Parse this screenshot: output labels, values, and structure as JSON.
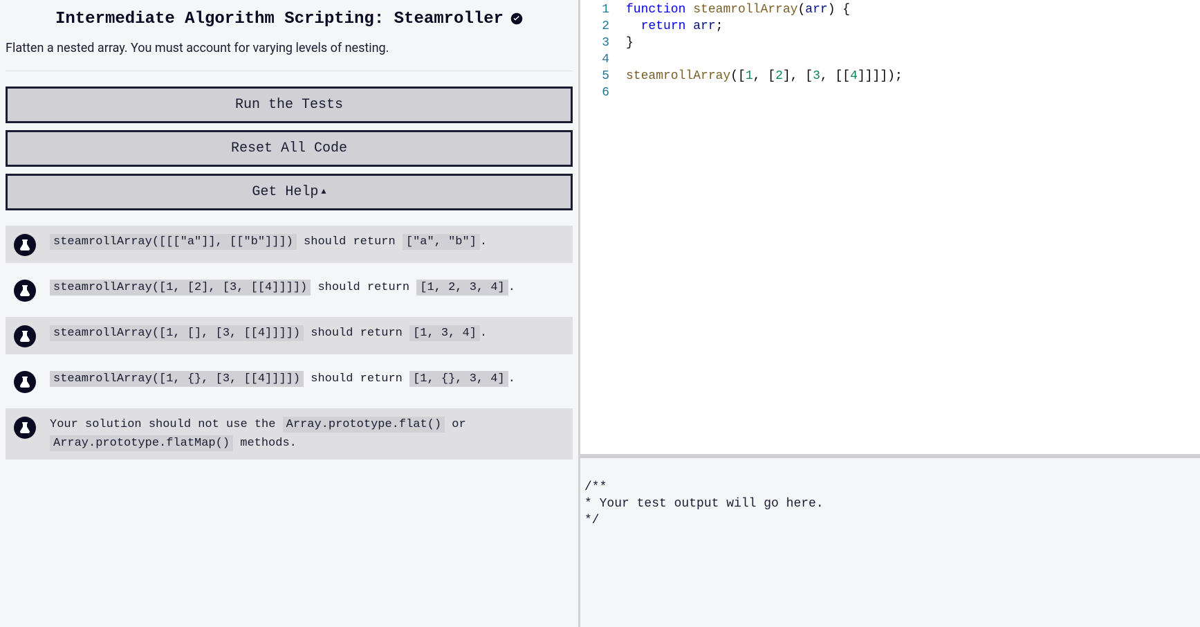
{
  "title": "Intermediate Algorithm Scripting: Steamroller",
  "description": "Flatten a nested array. You must account for varying levels of nesting.",
  "buttons": {
    "run": "Run the Tests",
    "reset": "Reset All Code",
    "help": "Get Help"
  },
  "tests": [
    {
      "segments": [
        {
          "t": "code",
          "v": "steamrollArray([[[\"a\"]], [[\"b\"]]])"
        },
        {
          "t": "text",
          "v": " should return "
        },
        {
          "t": "code",
          "v": "[\"a\", \"b\"]"
        },
        {
          "t": "text",
          "v": "."
        }
      ]
    },
    {
      "segments": [
        {
          "t": "code",
          "v": "steamrollArray([1, [2], [3, [[4]]]])"
        },
        {
          "t": "text",
          "v": " should return "
        },
        {
          "t": "code",
          "v": "[1, 2, 3, 4]"
        },
        {
          "t": "text",
          "v": "."
        }
      ]
    },
    {
      "segments": [
        {
          "t": "code",
          "v": "steamrollArray([1, [], [3, [[4]]]])"
        },
        {
          "t": "text",
          "v": " should return "
        },
        {
          "t": "code",
          "v": "[1, 3, 4]"
        },
        {
          "t": "text",
          "v": "."
        }
      ]
    },
    {
      "segments": [
        {
          "t": "code",
          "v": "steamrollArray([1, {}, [3, [[4]]]])"
        },
        {
          "t": "text",
          "v": " should return "
        },
        {
          "t": "code",
          "v": "[1, {}, 3, 4]"
        },
        {
          "t": "text",
          "v": "."
        }
      ]
    },
    {
      "segments": [
        {
          "t": "text",
          "v": "Your solution should not use the "
        },
        {
          "t": "code",
          "v": "Array.prototype.flat()"
        },
        {
          "t": "text",
          "v": " or "
        },
        {
          "t": "code",
          "v": "Array.prototype.flatMap()"
        },
        {
          "t": "text",
          "v": " methods."
        }
      ]
    }
  ],
  "editor": {
    "line_numbers": [
      "1",
      "2",
      "3",
      "4",
      "5",
      "6"
    ],
    "lines": [
      [
        {
          "c": "tok-kw",
          "v": "function"
        },
        {
          "c": "",
          "v": " "
        },
        {
          "c": "tok-fn",
          "v": "steamrollArray"
        },
        {
          "c": "tok-punc",
          "v": "("
        },
        {
          "c": "tok-id",
          "v": "arr"
        },
        {
          "c": "tok-punc",
          "v": ") {"
        }
      ],
      [
        {
          "c": "",
          "v": "  "
        },
        {
          "c": "tok-kw",
          "v": "return"
        },
        {
          "c": "",
          "v": " "
        },
        {
          "c": "tok-id",
          "v": "arr"
        },
        {
          "c": "tok-punc",
          "v": ";"
        }
      ],
      [
        {
          "c": "tok-punc",
          "v": "}"
        }
      ],
      [],
      [
        {
          "c": "tok-fn",
          "v": "steamrollArray"
        },
        {
          "c": "tok-punc",
          "v": "(["
        },
        {
          "c": "tok-num",
          "v": "1"
        },
        {
          "c": "tok-punc",
          "v": ", ["
        },
        {
          "c": "tok-num",
          "v": "2"
        },
        {
          "c": "tok-punc",
          "v": "], ["
        },
        {
          "c": "tok-num",
          "v": "3"
        },
        {
          "c": "tok-punc",
          "v": ", [["
        },
        {
          "c": "tok-num",
          "v": "4"
        },
        {
          "c": "tok-punc",
          "v": "]]]]);"
        }
      ],
      []
    ]
  },
  "output_text": "/**\n* Your test output will go here.\n*/"
}
